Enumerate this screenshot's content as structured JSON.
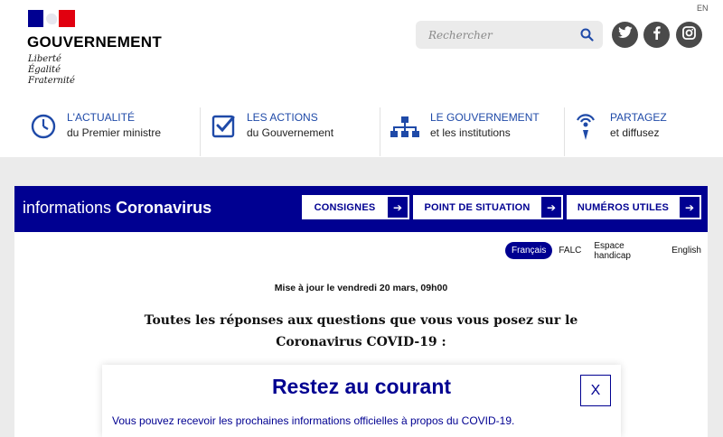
{
  "header": {
    "brand": "GOUVERNEMENT",
    "motto": [
      "Liberté",
      "Égalité",
      "Fraternité"
    ],
    "lang_en": "EN",
    "search_placeholder": "Rechercher"
  },
  "social": [
    {
      "name": "twitter",
      "icon": "twitter-icon"
    },
    {
      "name": "facebook",
      "icon": "facebook-icon"
    },
    {
      "name": "instagram",
      "icon": "instagram-icon"
    }
  ],
  "nav": [
    {
      "title": "L'ACTUALITÉ",
      "sub": "du Premier ministre",
      "icon": "clock-icon"
    },
    {
      "title": "LES ACTIONS",
      "sub": "du Gouvernement",
      "icon": "checkbox-icon"
    },
    {
      "title": "LE GOUVERNEMENT",
      "sub": "et les institutions",
      "icon": "org-chart-icon"
    },
    {
      "title": "PARTAGEZ",
      "sub": "et diffusez",
      "icon": "broadcast-icon"
    }
  ],
  "covid": {
    "title_prefix": "informations",
    "title_bold": "Coronavirus",
    "buttons": [
      "CONSIGNES",
      "POINT DE SITUATION",
      "NUMÉROS UTILES"
    ],
    "languages": [
      "Français",
      "FALC",
      "Espace handicap",
      "English"
    ],
    "updated": "Mise à jour le vendredi 20 mars, 09h00",
    "headline": "Toutes les réponses aux questions que vous vous posez sur le Coronavirus COVID-19 :"
  },
  "modal": {
    "title": "Restez au courant",
    "close": "X",
    "text": "Vous pouvez recevoir les prochaines informations officielles à propos du COVID-19."
  },
  "colors": {
    "brand_blue": "#000091",
    "flag_red": "#e1000f",
    "nav_blue": "#1f4aa8",
    "band_gray": "#ebebeb"
  }
}
